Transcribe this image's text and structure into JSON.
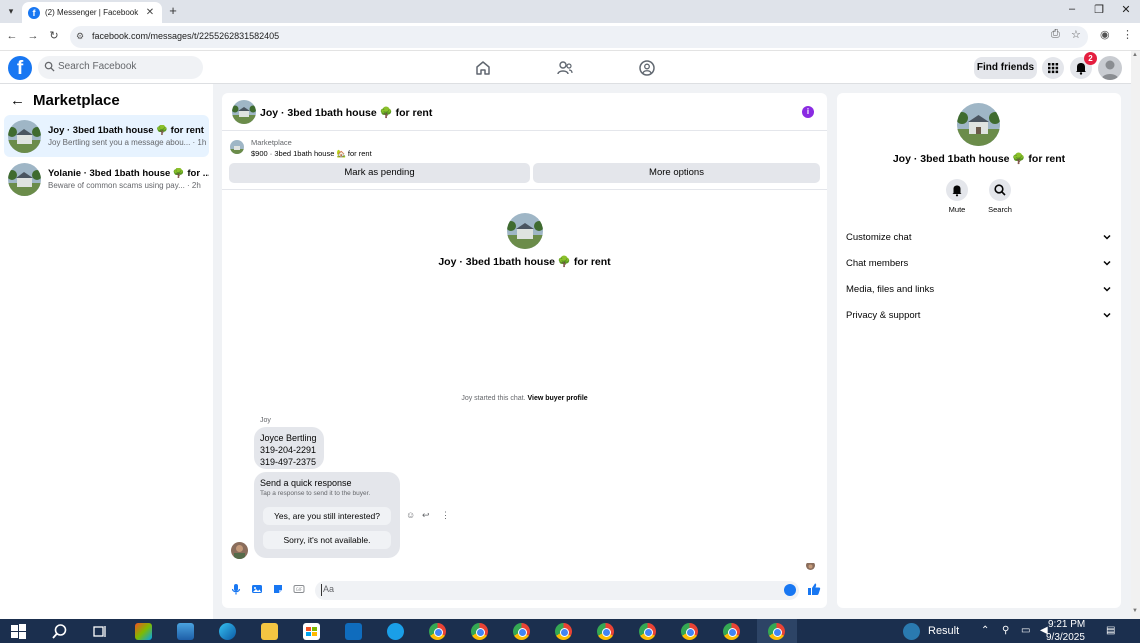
{
  "browser": {
    "tab_title": "(2) Messenger | Facebook",
    "url": "facebook.com/messages/t/2255262831582405",
    "new_tab": "+",
    "close_tab": "✕",
    "minimize": "–",
    "maximize": "❐",
    "close_window": "✕"
  },
  "fb": {
    "logo": "f",
    "search_placeholder": "Search Facebook",
    "find_friends": "Find friends",
    "notification_count": "2"
  },
  "left": {
    "title": "Marketplace",
    "conversations": [
      {
        "name": "Joy · 3bed 1bath house 🌳 for rent",
        "preview": "Joy Bertling sent you a message abou... · 1h"
      },
      {
        "name": "Yolanie · 3bed 1bath house 🌳 for ...",
        "preview": "Beware of common scams using pay... · 2h"
      }
    ]
  },
  "chat": {
    "title": "Joy · 3bed 1bath house 🌳 for rent",
    "listing_source": "Marketplace",
    "listing_detail": "$900 · 3bed 1bath house 🏡 for rent",
    "mark_pending": "Mark as pending",
    "more_options": "More options",
    "intro_title": "Joy · 3bed 1bath house 🌳 for rent",
    "started_text": "Joy started this chat.",
    "view_profile": "View buyer profile",
    "sender": "Joy",
    "message_lines": [
      "Joyce Bertling",
      "319-204-2291",
      "319-497-2375"
    ],
    "quick_title": "Send a quick response",
    "quick_sub": "Tap a response to send it to the buyer.",
    "quick_1": "Yes, are you still interested?",
    "quick_2": "Sorry, it's not available.",
    "composer_placeholder": "Aa"
  },
  "details": {
    "title": "Joy · 3bed 1bath house 🌳 for rent",
    "mute": "Mute",
    "search": "Search",
    "rows": [
      "Customize chat",
      "Chat members",
      "Media, files and links",
      "Privacy & support"
    ]
  },
  "taskbar": {
    "result_label": "Result",
    "time": "9:21 PM",
    "date": "9/3/2025"
  },
  "colors": {
    "fb_blue": "#1877f2",
    "active_conv": "#e7f3ff",
    "info_purple": "#8a2be2",
    "badge_red": "#e41e3f",
    "taskbar": "#1b2f4e"
  }
}
